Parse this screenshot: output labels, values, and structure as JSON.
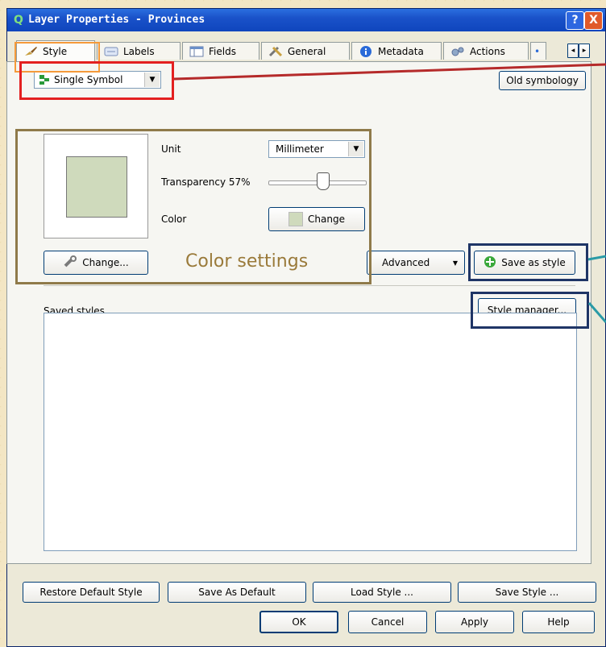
{
  "window": {
    "title": "Layer Properties - Provinces",
    "help_glyph": "?",
    "close_glyph": "X"
  },
  "tabs": [
    {
      "label": "Style",
      "icon": "paintbrush-icon",
      "active": true
    },
    {
      "label": "Labels",
      "icon": "label-icon"
    },
    {
      "label": "Fields",
      "icon": "table-icon"
    },
    {
      "label": "General",
      "icon": "tools-icon"
    },
    {
      "label": "Metadata",
      "icon": "info-icon"
    },
    {
      "label": "Actions",
      "icon": "gears-icon"
    }
  ],
  "tab_scroll": {
    "left": "◂",
    "right": "▸"
  },
  "renderer": {
    "value": "Single Symbol",
    "old_symbology": "Old symbology"
  },
  "symbol": {
    "unit_label": "Unit",
    "unit_value": "Millimeter",
    "transparency_label": "Transparency 57%",
    "transparency": 0.57,
    "color_label": "Color",
    "color_change": "Change",
    "swatch_color": "#cfdabc",
    "change_symbol": "Change...",
    "advanced": "Advanced",
    "save_as_style": "Save as style"
  },
  "annotation": {
    "color_settings": "Color settings"
  },
  "saved_styles": {
    "label": "Saved styles",
    "style_manager": "Style manager..."
  },
  "bottom": {
    "restore_default": "Restore Default Style",
    "save_as_default": "Save As Default",
    "load_style": "Load Style ...",
    "save_style": "Save Style ...",
    "ok": "OK",
    "cancel": "Cancel",
    "apply": "Apply",
    "help": "Help"
  },
  "colors": {
    "accent_orange": "#f59a3a",
    "accent_red": "#e32020",
    "accent_olive": "#8f7a4a",
    "accent_navy": "#1f3566",
    "teal_line": "#2a9aa6"
  }
}
